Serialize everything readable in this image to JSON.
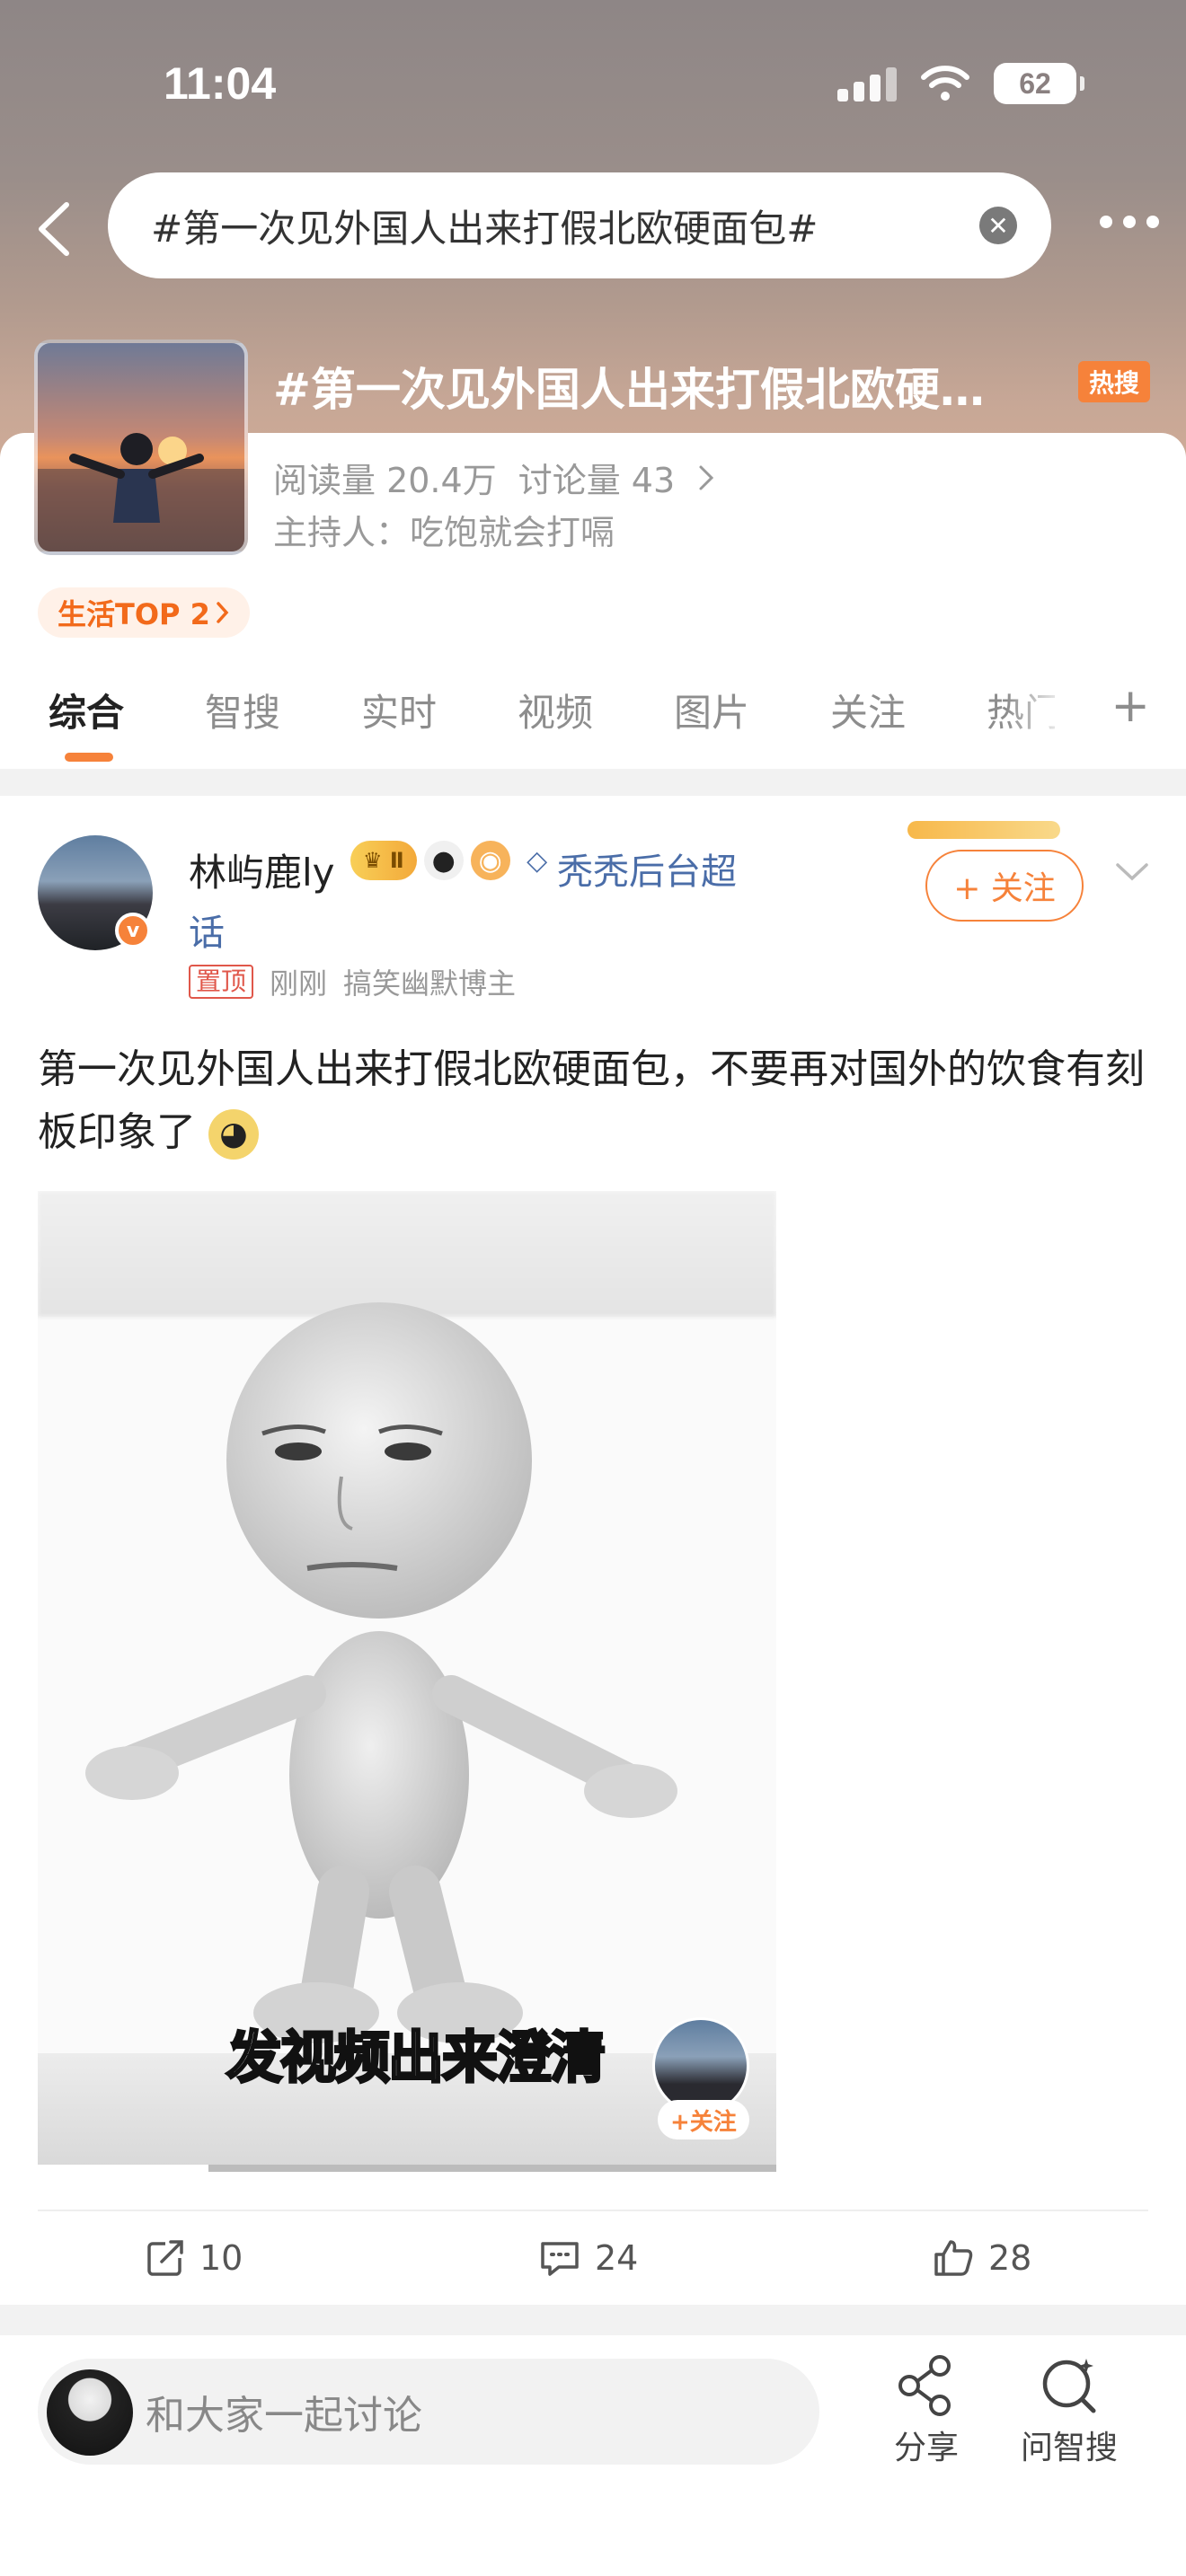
{
  "status": {
    "time": "11:04",
    "battery": "62"
  },
  "search": {
    "query": "#第一次见外国人出来打假北欧硬面包#"
  },
  "topic": {
    "title": "#第一次见外国人出来打假北欧硬…",
    "hot_label": "热搜",
    "reads_label": "阅读量 20.4万",
    "discussion_label": "讨论量 43",
    "host_label": "主持人：吃饱就会打嗝",
    "rank_chip": "生活TOP 2"
  },
  "tabs": [
    "综合",
    "智搜",
    "实时",
    "视频",
    "图片",
    "关注",
    "热门"
  ],
  "post": {
    "user_name": "林屿鹿ly",
    "level_badge": "Ⅱ",
    "super_topic_part1": "秃秃后台超",
    "super_topic_part2": "话",
    "pin_tag": "置顶",
    "time": "刚刚",
    "category": "搞笑幽默博主",
    "follow_label": "+ 关注",
    "text": "第一次见外国人出来打假北欧硬面包，不要再对国外的饮食有刻板印象了",
    "video_caption": "发视频出来澄清",
    "video_follow": "+关注",
    "reposts": "10",
    "comments": "24",
    "likes": "28"
  },
  "bottom": {
    "comment_placeholder": "和大家一起讨论",
    "share_label": "分享",
    "ask_label": "问智搜"
  },
  "colors": {
    "accent": "#f6823a",
    "link": "#4a6da8"
  },
  "icons": [
    "back-icon",
    "clear-icon",
    "more-icon",
    "chevron-right-icon",
    "plus-icon",
    "chevron-down-icon",
    "repost-icon",
    "comment-icon",
    "like-icon",
    "share-icon",
    "ask-search-icon"
  ]
}
